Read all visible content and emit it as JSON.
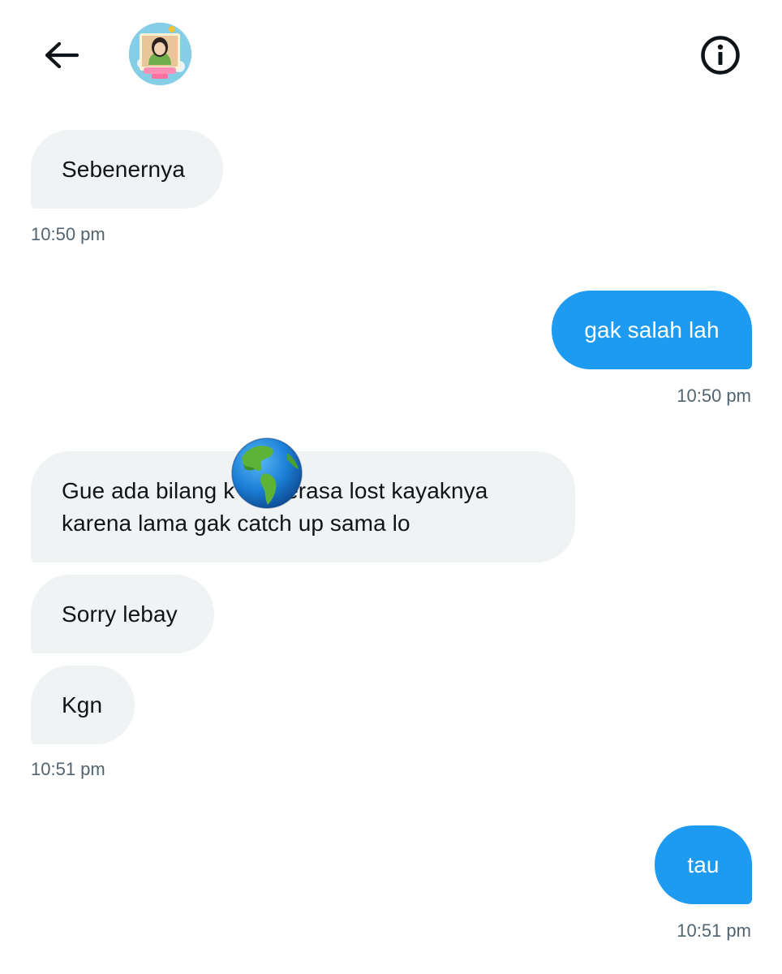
{
  "header": {
    "back_icon": "arrow-left-icon",
    "info_icon": "info-circle-icon"
  },
  "messages": [
    {
      "direction": "in",
      "text": "Sebenernya"
    },
    {
      "direction": "out",
      "text": "gak salah lah"
    },
    {
      "direction": "in",
      "text": "Gue ada bilang k       a ngerasa lost kayaknya\nkarena lama gak catch up sama lo"
    },
    {
      "direction": "in",
      "text": "Sorry lebay"
    },
    {
      "direction": "in",
      "text": "Kgn"
    },
    {
      "direction": "out",
      "text": "tau"
    }
  ],
  "timestamps": [
    "10:50 pm",
    "10:50 pm",
    "10:51 pm",
    "10:51 pm"
  ],
  "sticker": {
    "icon": "earth-globe-americas-icon"
  },
  "colors": {
    "incoming_bubble": "#eff3f4",
    "outgoing_bubble": "#1d9bf0",
    "timestamp": "#536471",
    "text": "#0f1419"
  }
}
